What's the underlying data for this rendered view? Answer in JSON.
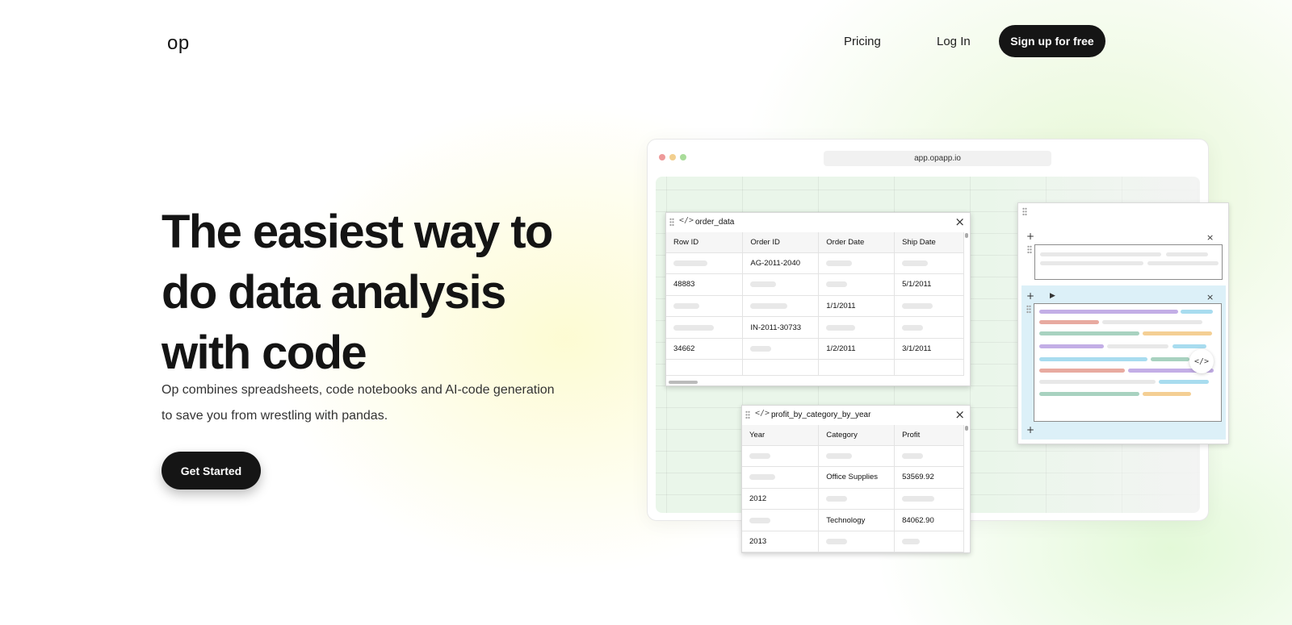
{
  "nav": {
    "logo": "op",
    "pricing": "Pricing",
    "login": "Log In",
    "signup": "Sign up for free"
  },
  "hero": {
    "title_line1": "The easiest way to",
    "title_line2": "do data analysis",
    "title_line3": "with code",
    "subtitle_line1": "Op combines spreadsheets, code notebooks and AI-code generation",
    "subtitle_line2": "to save you from wrestling with pandas.",
    "cta": "Get Started"
  },
  "browser": {
    "url": "app.opapp.io"
  },
  "order_table": {
    "title": "order_data",
    "icon": "code-icon",
    "columns": [
      "Row ID",
      "Order ID",
      "Order Date",
      "Ship Date"
    ],
    "rows": [
      [
        "",
        "AG-2011-2040",
        "",
        ""
      ],
      [
        "48883",
        "",
        "",
        "5/1/2011"
      ],
      [
        "",
        "",
        "1/1/2011",
        ""
      ],
      [
        "",
        "IN-2011-30733",
        "",
        ""
      ],
      [
        "34662",
        "",
        "1/2/2011",
        "3/1/2011"
      ],
      [
        "",
        "",
        "",
        ""
      ]
    ]
  },
  "profit_table": {
    "title": "profit_by_category_by_year",
    "icon": "code-icon",
    "columns": [
      "Year",
      "Category",
      "Profit"
    ],
    "rows": [
      [
        "",
        "",
        ""
      ],
      [
        "",
        "Office Supplies",
        "53569.92"
      ],
      [
        "2012",
        "",
        ""
      ],
      [
        "",
        "Technology",
        "84062.90"
      ],
      [
        "2013",
        "",
        ""
      ]
    ]
  },
  "notebook": {
    "add_icon": "+",
    "close_icon": "×",
    "run_icon": "▶",
    "code_icon": "</>"
  },
  "colors": {
    "primary_button": "#151515",
    "code_purple": "#c3aee6",
    "code_blue": "#a8dcef",
    "code_red": "#e8aaa0",
    "code_green": "#a8d2c0",
    "code_orange": "#f4cf94"
  }
}
